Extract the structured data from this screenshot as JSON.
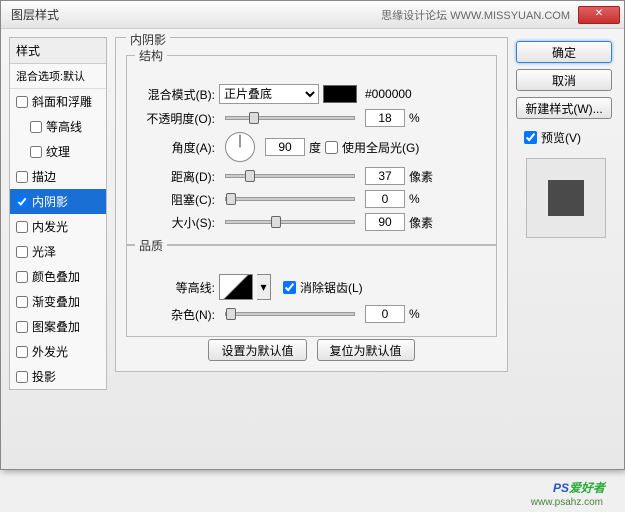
{
  "title": "图层样式",
  "forum": "思缘设计论坛 WWW.MISSYUAN.COM",
  "close_x": "✕",
  "styles": {
    "header": "样式",
    "sub": "混合选项:默认",
    "items": [
      {
        "label": "斜面和浮雕",
        "checked": false,
        "indent": false
      },
      {
        "label": "等高线",
        "checked": false,
        "indent": true
      },
      {
        "label": "纹理",
        "checked": false,
        "indent": true
      },
      {
        "label": "描边",
        "checked": false,
        "indent": false
      },
      {
        "label": "内阴影",
        "checked": true,
        "indent": false,
        "selected": true
      },
      {
        "label": "内发光",
        "checked": false,
        "indent": false
      },
      {
        "label": "光泽",
        "checked": false,
        "indent": false
      },
      {
        "label": "颜色叠加",
        "checked": false,
        "indent": false
      },
      {
        "label": "渐变叠加",
        "checked": false,
        "indent": false
      },
      {
        "label": "图案叠加",
        "checked": false,
        "indent": false
      },
      {
        "label": "外发光",
        "checked": false,
        "indent": false
      },
      {
        "label": "投影",
        "checked": false,
        "indent": false
      }
    ]
  },
  "panel": {
    "title": "内阴影",
    "structure": {
      "title": "结构",
      "blend_label": "混合模式(B):",
      "blend_mode": "正片叠底",
      "color_hex": "#000000",
      "opacity_label": "不透明度(O):",
      "opacity": "18",
      "opacity_unit": "%",
      "angle_label": "角度(A):",
      "angle": "90",
      "angle_unit": "度",
      "global_label": "使用全局光(G)",
      "distance_label": "距离(D):",
      "distance": "37",
      "px_unit": "像素",
      "choke_label": "阻塞(C):",
      "choke": "0",
      "choke_unit": "%",
      "size_label": "大小(S):",
      "size": "90"
    },
    "quality": {
      "title": "品质",
      "contour_label": "等高线:",
      "antialias_label": "消除锯齿(L)",
      "noise_label": "杂色(N):",
      "noise": "0",
      "noise_unit": "%"
    },
    "defaults_btn": "设置为默认值",
    "reset_btn": "复位为默认值"
  },
  "right": {
    "ok": "确定",
    "cancel": "取消",
    "new_style": "新建样式(W)...",
    "preview_label": "预览(V)"
  },
  "watermark": {
    "ps": "PS",
    "rest": "爱好者",
    "url": "www.psahz.com"
  }
}
